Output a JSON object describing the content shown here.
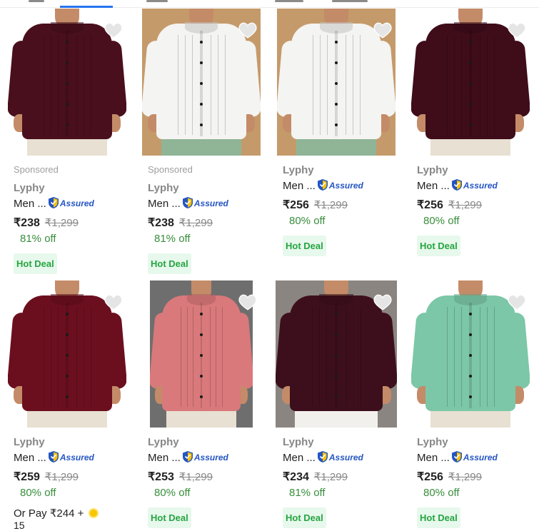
{
  "products": [
    {
      "sponsored": "Sponsored",
      "brand": "Lyphy",
      "title": "Men ...",
      "assured": "Assured",
      "price": "₹238",
      "mrp": "₹1,299",
      "discount": "81% off",
      "badge": "Hot Deal",
      "colors": {
        "bg": "#ffffff",
        "shirt": "#4a0f1c",
        "pants": "#e8e0d2"
      }
    },
    {
      "sponsored": "Sponsored",
      "brand": "Lyphy",
      "title": "Men ...",
      "assured": "Assured",
      "price": "₹238",
      "mrp": "₹1,299",
      "discount": "81% off",
      "badge": "Hot Deal",
      "colors": {
        "bg": "#c59a6a",
        "shirt": "#f4f4f2",
        "pants": "#8fb596"
      }
    },
    {
      "brand": "Lyphy",
      "title": "Men ...",
      "assured": "Assured",
      "price": "₹256",
      "mrp": "₹1,299",
      "discount": "80% off",
      "badge": "Hot Deal",
      "colors": {
        "bg": "#c59a6a",
        "shirt": "#f4f4f2",
        "pants": "#8fb596"
      }
    },
    {
      "brand": "Lyphy",
      "title": "Men ...",
      "assured": "Assured",
      "price": "₹256",
      "mrp": "₹1,299",
      "discount": "80% off",
      "badge": "Hot Deal",
      "colors": {
        "bg": "#ffffff",
        "shirt": "#3f0c1a",
        "pants": "#e8e0d2"
      }
    },
    {
      "brand": "Lyphy",
      "title": "Men ...",
      "assured": "Assured",
      "price": "₹259",
      "mrp": "₹1,299",
      "discount": "80% off",
      "pay_with": "Or Pay ₹244 +",
      "pay_with_2": "15",
      "colors": {
        "bg": "#ffffff",
        "shirt": "#6b0f1f",
        "pants": "#e8e0d2"
      }
    },
    {
      "brand": "Lyphy",
      "title": "Men ...",
      "assured": "Assured",
      "price": "₹253",
      "mrp": "₹1,299",
      "discount": "80% off",
      "badge": "Hot Deal",
      "colors": {
        "bg": "#6e6e6e",
        "shirt": "#d9797b",
        "pants": "#e8e0d2"
      }
    },
    {
      "brand": "Lyphy",
      "title": "Men ...",
      "assured": "Assured",
      "price": "₹234",
      "mrp": "₹1,299",
      "discount": "81% off",
      "badge": "Hot Deal",
      "colors": {
        "bg": "#8a8580",
        "shirt": "#3d0f1c",
        "pants": "#f2f0ec"
      }
    },
    {
      "brand": "Lyphy",
      "title": "Men ...",
      "assured": "Assured",
      "price": "₹256",
      "mrp": "₹1,299",
      "discount": "80% off",
      "badge": "Hot Deal",
      "colors": {
        "bg": "#ffffff",
        "shirt": "#7cc7a7",
        "pants": "#e8e0d2"
      }
    }
  ]
}
